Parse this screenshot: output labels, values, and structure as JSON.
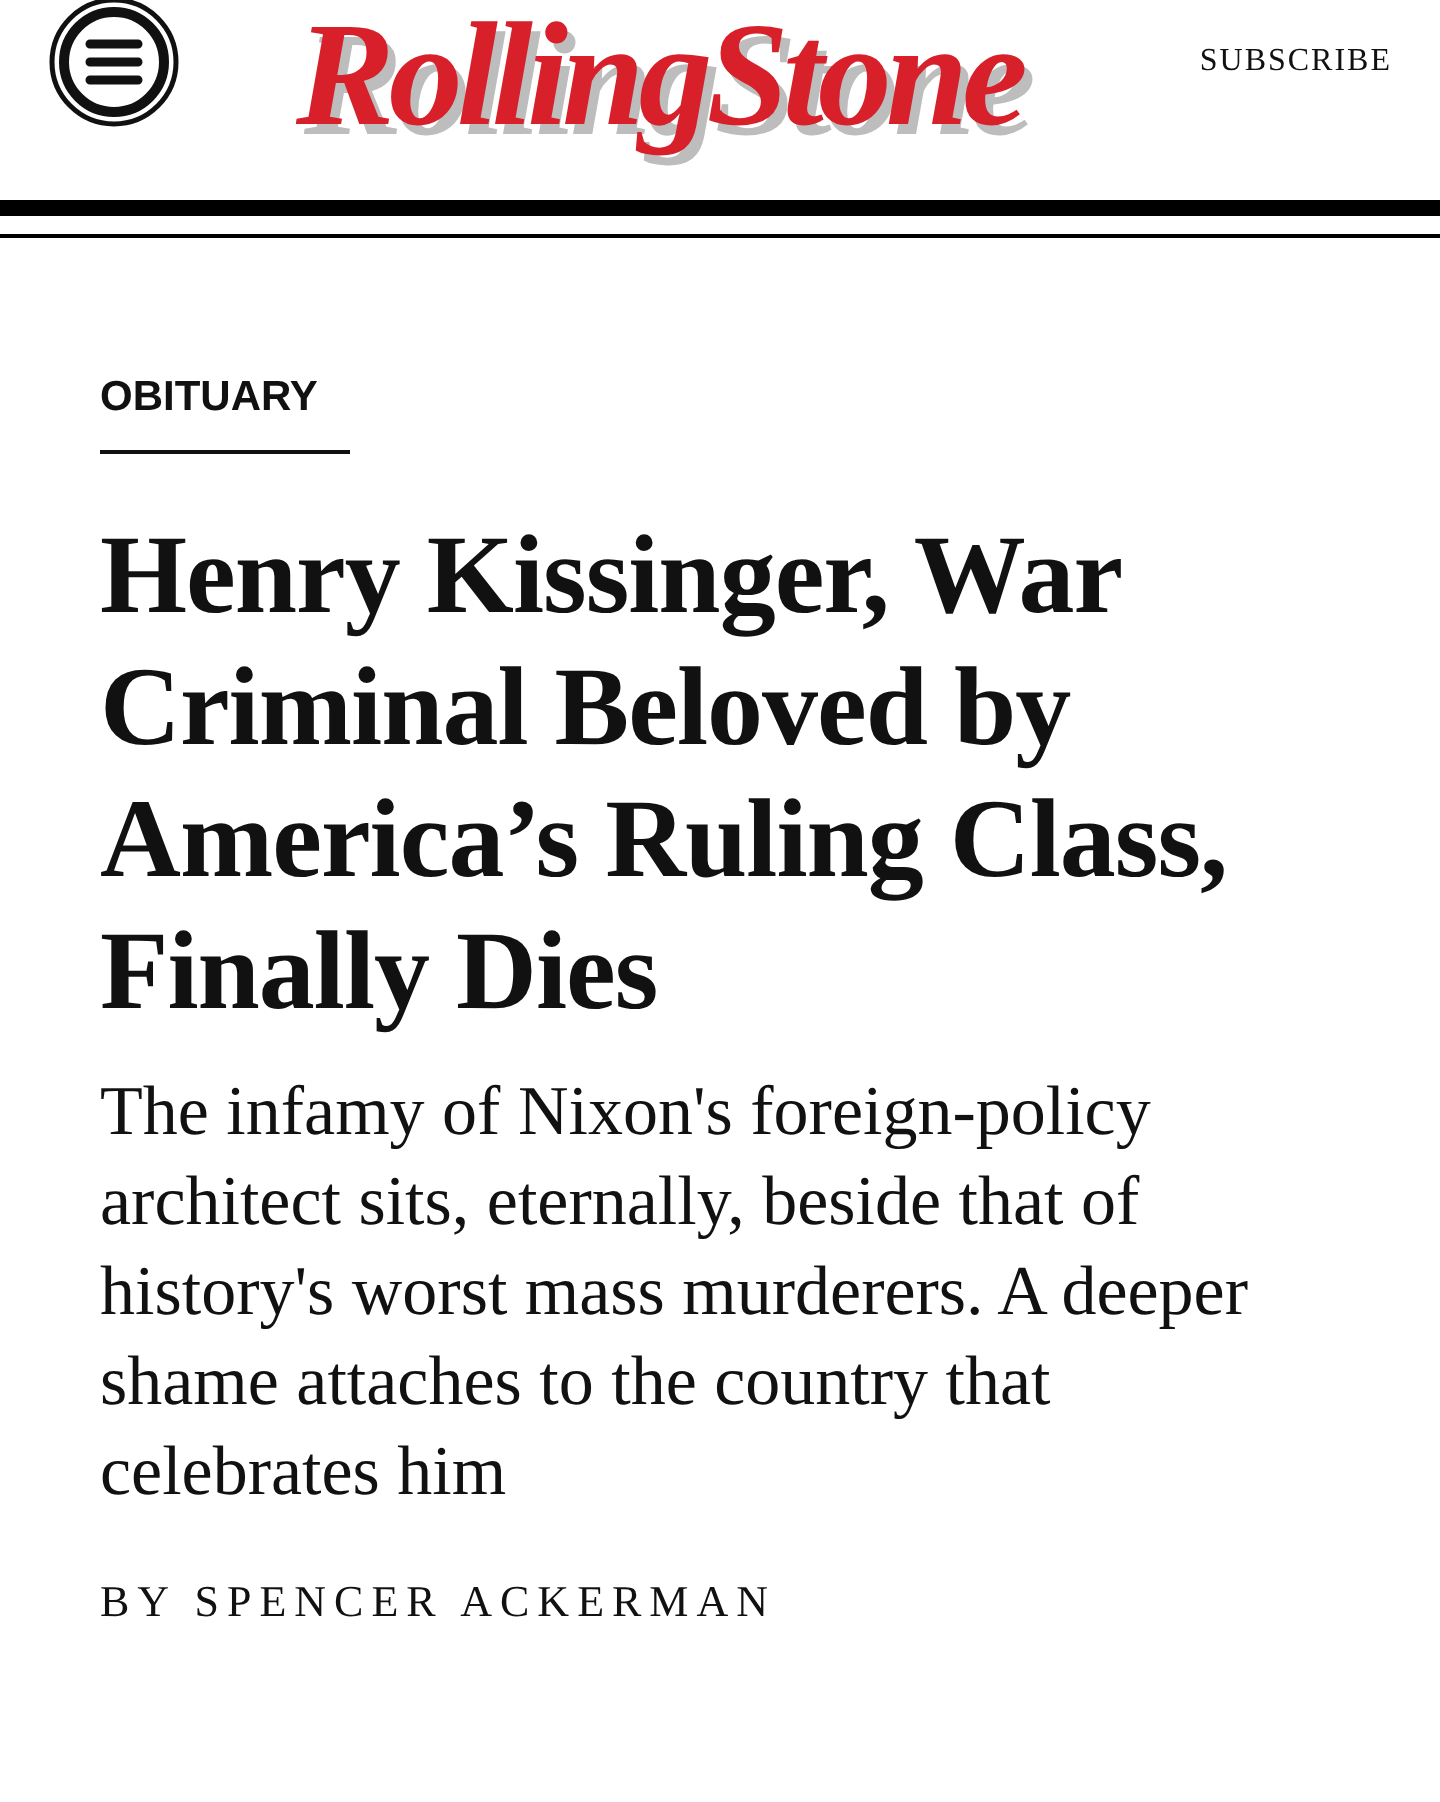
{
  "header": {
    "logo": "RollingStone",
    "subscribe": "SUBSCRIBE"
  },
  "article": {
    "category": "OBITUARY",
    "headline": "Henry Kissinger, War Criminal Beloved by America’s Ruling Class, Finally Dies",
    "deck": "The infamy of Nixon's foreign-policy architect sits, eternally, beside that of history's worst mass murderers. A deeper shame attaches to the country that celebrates him",
    "byline": "BY SPENCER ACKERMAN"
  }
}
